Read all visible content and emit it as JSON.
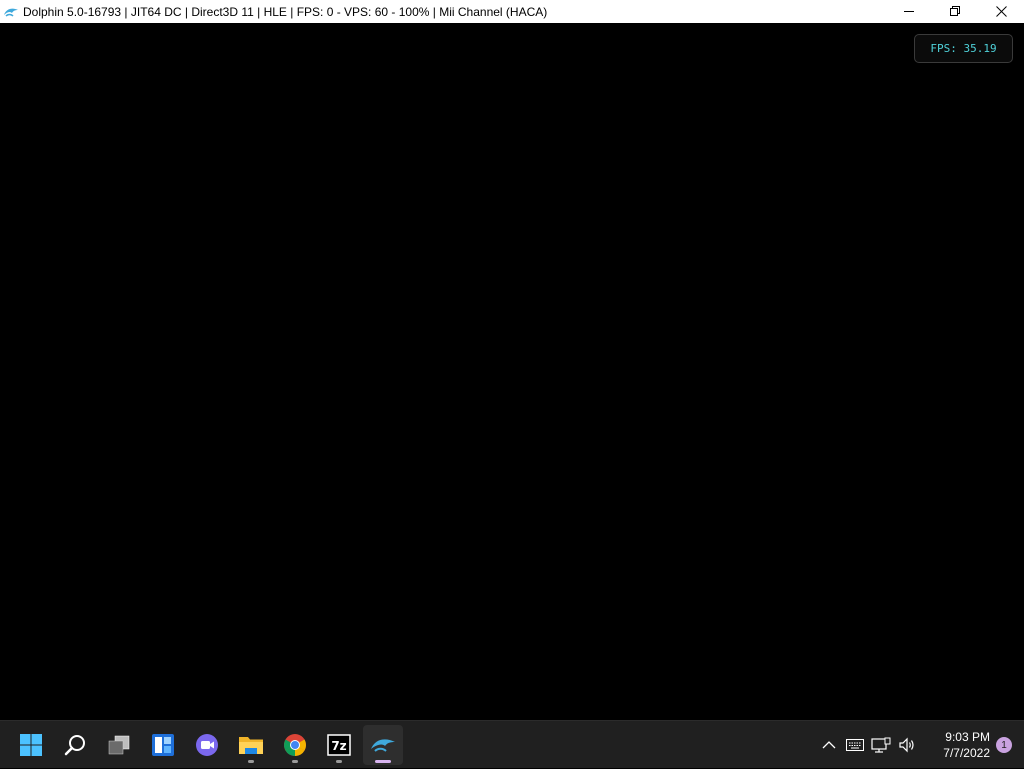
{
  "window": {
    "title": "Dolphin 5.0-16793 | JIT64 DC | Direct3D 11 | HLE | FPS: 0 - VPS: 60 - 100% | Mii Channel (HACA)",
    "app_icon": "dolphin-icon",
    "controls": {
      "minimize": "—",
      "maximize": "❐",
      "close": "✕"
    }
  },
  "overlay": {
    "fps_text": "FPS: 35.19"
  },
  "taskbar": {
    "apps": [
      {
        "name": "start-button",
        "icon": "windows-logo-icon",
        "active": false,
        "running": false
      },
      {
        "name": "search-button",
        "icon": "search-icon",
        "active": false,
        "running": false
      },
      {
        "name": "task-view-button",
        "icon": "task-view-icon",
        "active": false,
        "running": false
      },
      {
        "name": "widgets-button",
        "icon": "widgets-icon",
        "active": false,
        "running": false
      },
      {
        "name": "chat-button",
        "icon": "teams-chat-icon",
        "active": false,
        "running": false
      },
      {
        "name": "file-explorer-button",
        "icon": "folder-icon",
        "active": false,
        "running": true
      },
      {
        "name": "chrome-button",
        "icon": "chrome-icon",
        "active": false,
        "running": true
      },
      {
        "name": "7zip-button",
        "icon": "7zip-icon",
        "active": false,
        "running": true
      },
      {
        "name": "dolphin-button",
        "icon": "dolphin-icon",
        "active": true,
        "running": true
      }
    ],
    "tray": {
      "show_hidden": "^",
      "time": "9:03 PM",
      "date": "7/7/2022",
      "notification_count": "1"
    }
  },
  "colors": {
    "overlay_text": "#4fd1d9",
    "taskbar_bg": "#202020",
    "accent": "#d8b4f0"
  }
}
